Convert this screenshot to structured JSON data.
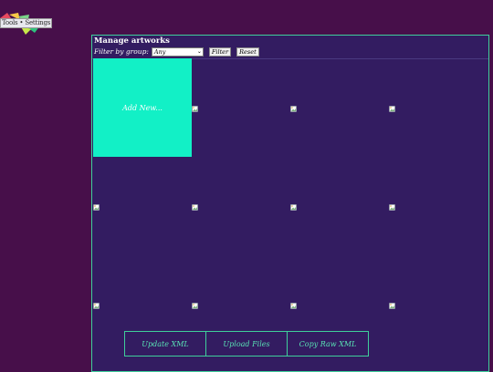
{
  "header": {
    "logo_text": "Tools • Settings"
  },
  "panel": {
    "title": "Manage artworks",
    "filter_label": "Filter by group:",
    "group_select_value": "Any",
    "filter_button": "Filter",
    "reset_button": "Reset",
    "add_new_label": "Add New..."
  },
  "artworks": [
    {
      "icon": "broken-image-icon"
    },
    {
      "icon": "broken-image-icon"
    },
    {
      "icon": "broken-image-icon"
    },
    {
      "icon": "broken-image-icon"
    },
    {
      "icon": "broken-image-icon"
    },
    {
      "icon": "broken-image-icon"
    },
    {
      "icon": "broken-image-icon"
    },
    {
      "icon": "broken-image-icon"
    },
    {
      "icon": "broken-image-icon"
    },
    {
      "icon": "broken-image-icon"
    },
    {
      "icon": "broken-image-icon"
    }
  ],
  "actions": {
    "update_xml": "Update XML",
    "upload_files": "Upload Files",
    "copy_raw_xml": "Copy Raw XML"
  },
  "colors": {
    "page_background": "#470f4a",
    "panel_background": "#331c61",
    "accent": "#3fcf9b",
    "add_new_tile": "#12f0c6"
  }
}
